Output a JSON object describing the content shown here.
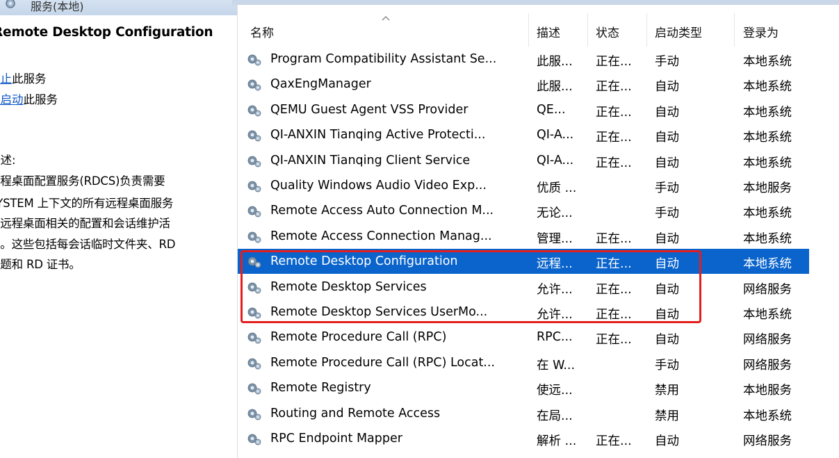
{
  "left_pane": {
    "header_title": "服务(本地)",
    "service_title": "Remote Desktop Configuration",
    "stop_link": "停止",
    "stop_suffix": "此服务",
    "restart_link": "重启动",
    "restart_suffix": "此服务",
    "description_heading": "描述:",
    "description_lines": [
      "远程桌面配置服务(RDCS)负责需要",
      "SYSTEM 上下文的所有远程桌面服务",
      "和远程桌面相关的配置和会话维护活",
      "动。这些包括每会话临时文件夹、RD",
      "主题和 RD 证书。"
    ]
  },
  "columns": {
    "name": "名称",
    "description": "描述",
    "status": "状态",
    "startup_type": "启动类型",
    "log_on_as": "登录为"
  },
  "services": [
    {
      "name": "Program Compatibility Assistant Se...",
      "description": "此服...",
      "status": "正在...",
      "startup_type": "手动",
      "log_on_as": "本地系统"
    },
    {
      "name": "QaxEngManager",
      "description": "此服...",
      "status": "正在...",
      "startup_type": "自动",
      "log_on_as": "本地系统"
    },
    {
      "name": "QEMU Guest Agent VSS Provider",
      "description": "QE...",
      "status": "正在...",
      "startup_type": "自动",
      "log_on_as": "本地系统"
    },
    {
      "name": "QI-ANXIN Tianqing Active Protecti...",
      "description": "QI-A...",
      "status": "正在...",
      "startup_type": "自动",
      "log_on_as": "本地系统"
    },
    {
      "name": "QI-ANXIN Tianqing Client Service",
      "description": "QI-A...",
      "status": "正在...",
      "startup_type": "自动",
      "log_on_as": "本地系统"
    },
    {
      "name": "Quality Windows Audio Video Exp...",
      "description": "优质 ...",
      "status": "",
      "startup_type": "手动",
      "log_on_as": "本地服务"
    },
    {
      "name": "Remote Access Auto Connection M...",
      "description": "无论...",
      "status": "",
      "startup_type": "手动",
      "log_on_as": "本地系统"
    },
    {
      "name": "Remote Access Connection Manag...",
      "description": "管理...",
      "status": "正在...",
      "startup_type": "自动",
      "log_on_as": "本地系统"
    },
    {
      "name": "Remote Desktop Configuration",
      "description": "远程...",
      "status": "正在...",
      "startup_type": "自动",
      "log_on_as": "本地系统",
      "selected": true
    },
    {
      "name": "Remote Desktop Services",
      "description": "允许...",
      "status": "正在...",
      "startup_type": "自动",
      "log_on_as": "网络服务"
    },
    {
      "name": "Remote Desktop Services UserMo...",
      "description": "允许...",
      "status": "正在...",
      "startup_type": "自动",
      "log_on_as": "本地系统"
    },
    {
      "name": "Remote Procedure Call (RPC)",
      "description": "RPC...",
      "status": "正在...",
      "startup_type": "自动",
      "log_on_as": "网络服务"
    },
    {
      "name": "Remote Procedure Call (RPC) Locat...",
      "description": "在 W...",
      "status": "",
      "startup_type": "手动",
      "log_on_as": "网络服务"
    },
    {
      "name": "Remote Registry",
      "description": "使远...",
      "status": "",
      "startup_type": "禁用",
      "log_on_as": "本地服务"
    },
    {
      "name": "Routing and Remote Access",
      "description": "在局...",
      "status": "",
      "startup_type": "禁用",
      "log_on_as": "本地系统"
    },
    {
      "name": "RPC Endpoint Mapper",
      "description": "解析 ...",
      "status": "正在...",
      "startup_type": "自动",
      "log_on_as": "网络服务"
    }
  ],
  "colors": {
    "selection": "#0a64cc",
    "highlight_box": "#e41e1e",
    "link": "#0b55c4"
  },
  "icons": {
    "service_row": "gear-icon",
    "sort": "sort-ascending-icon"
  }
}
